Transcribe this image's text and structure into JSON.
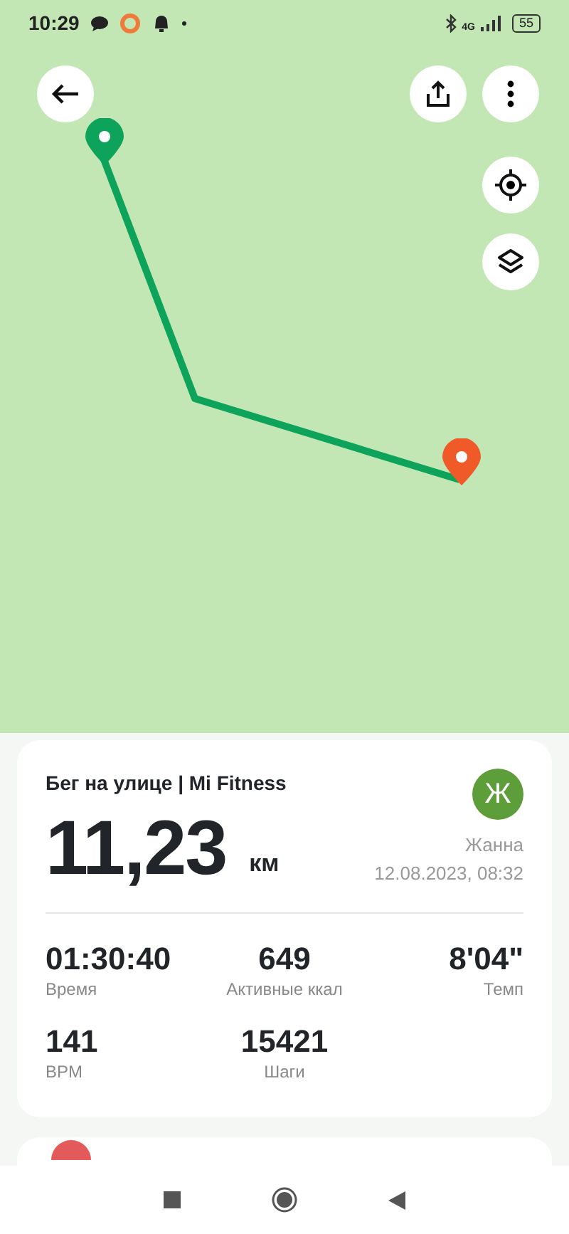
{
  "status_bar": {
    "time": "10:29",
    "network": "4G",
    "battery": "55"
  },
  "title": "Бег на улице | Mi Fitness",
  "distance": {
    "value": "11,23",
    "unit": "км"
  },
  "user": {
    "initial": "Ж",
    "name": "Жанна",
    "date": "12.08.2023, 08:32",
    "color": "#5e9e3a"
  },
  "stats": [
    {
      "value": "01:30:40",
      "label": "Время"
    },
    {
      "value": "649",
      "label": "Активные ккал"
    },
    {
      "value": "8'04\"",
      "label": "Темп"
    },
    {
      "value": "141",
      "label": "BPM"
    },
    {
      "value": "15421",
      "label": "Шаги"
    }
  ]
}
